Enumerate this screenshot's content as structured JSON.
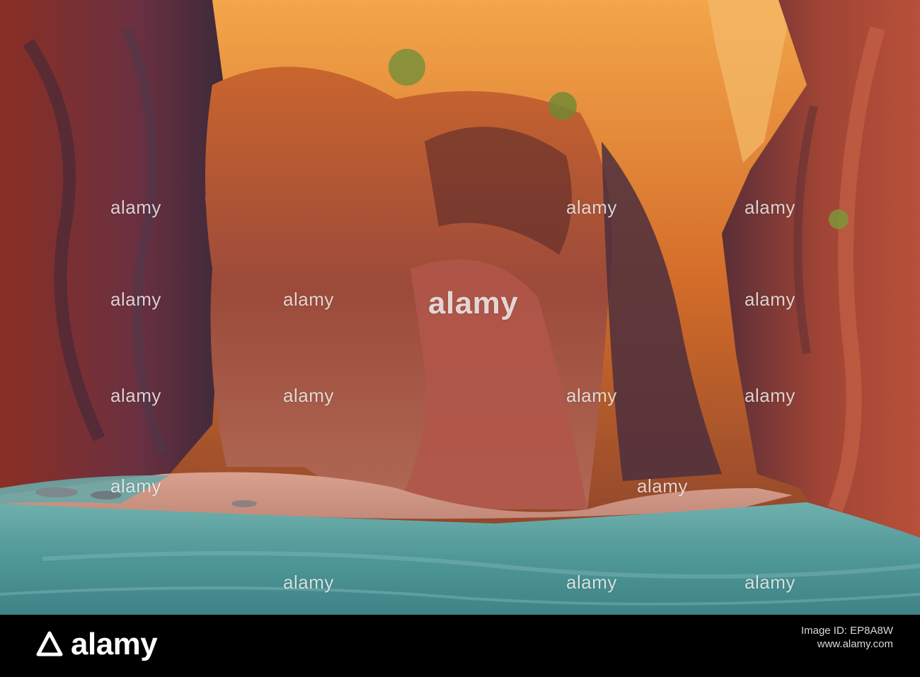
{
  "photo": {
    "scene": "The Narrows sandstone canyon with river"
  },
  "watermark": {
    "text": "alamy"
  },
  "footer": {
    "brand": "alamy",
    "label": "Image ID: EP8A8W",
    "url": "www.alamy.com"
  },
  "colors": {
    "footer_bg": "#000000",
    "canyon_glow": "#e8902c",
    "river": "#5fa6a6"
  }
}
